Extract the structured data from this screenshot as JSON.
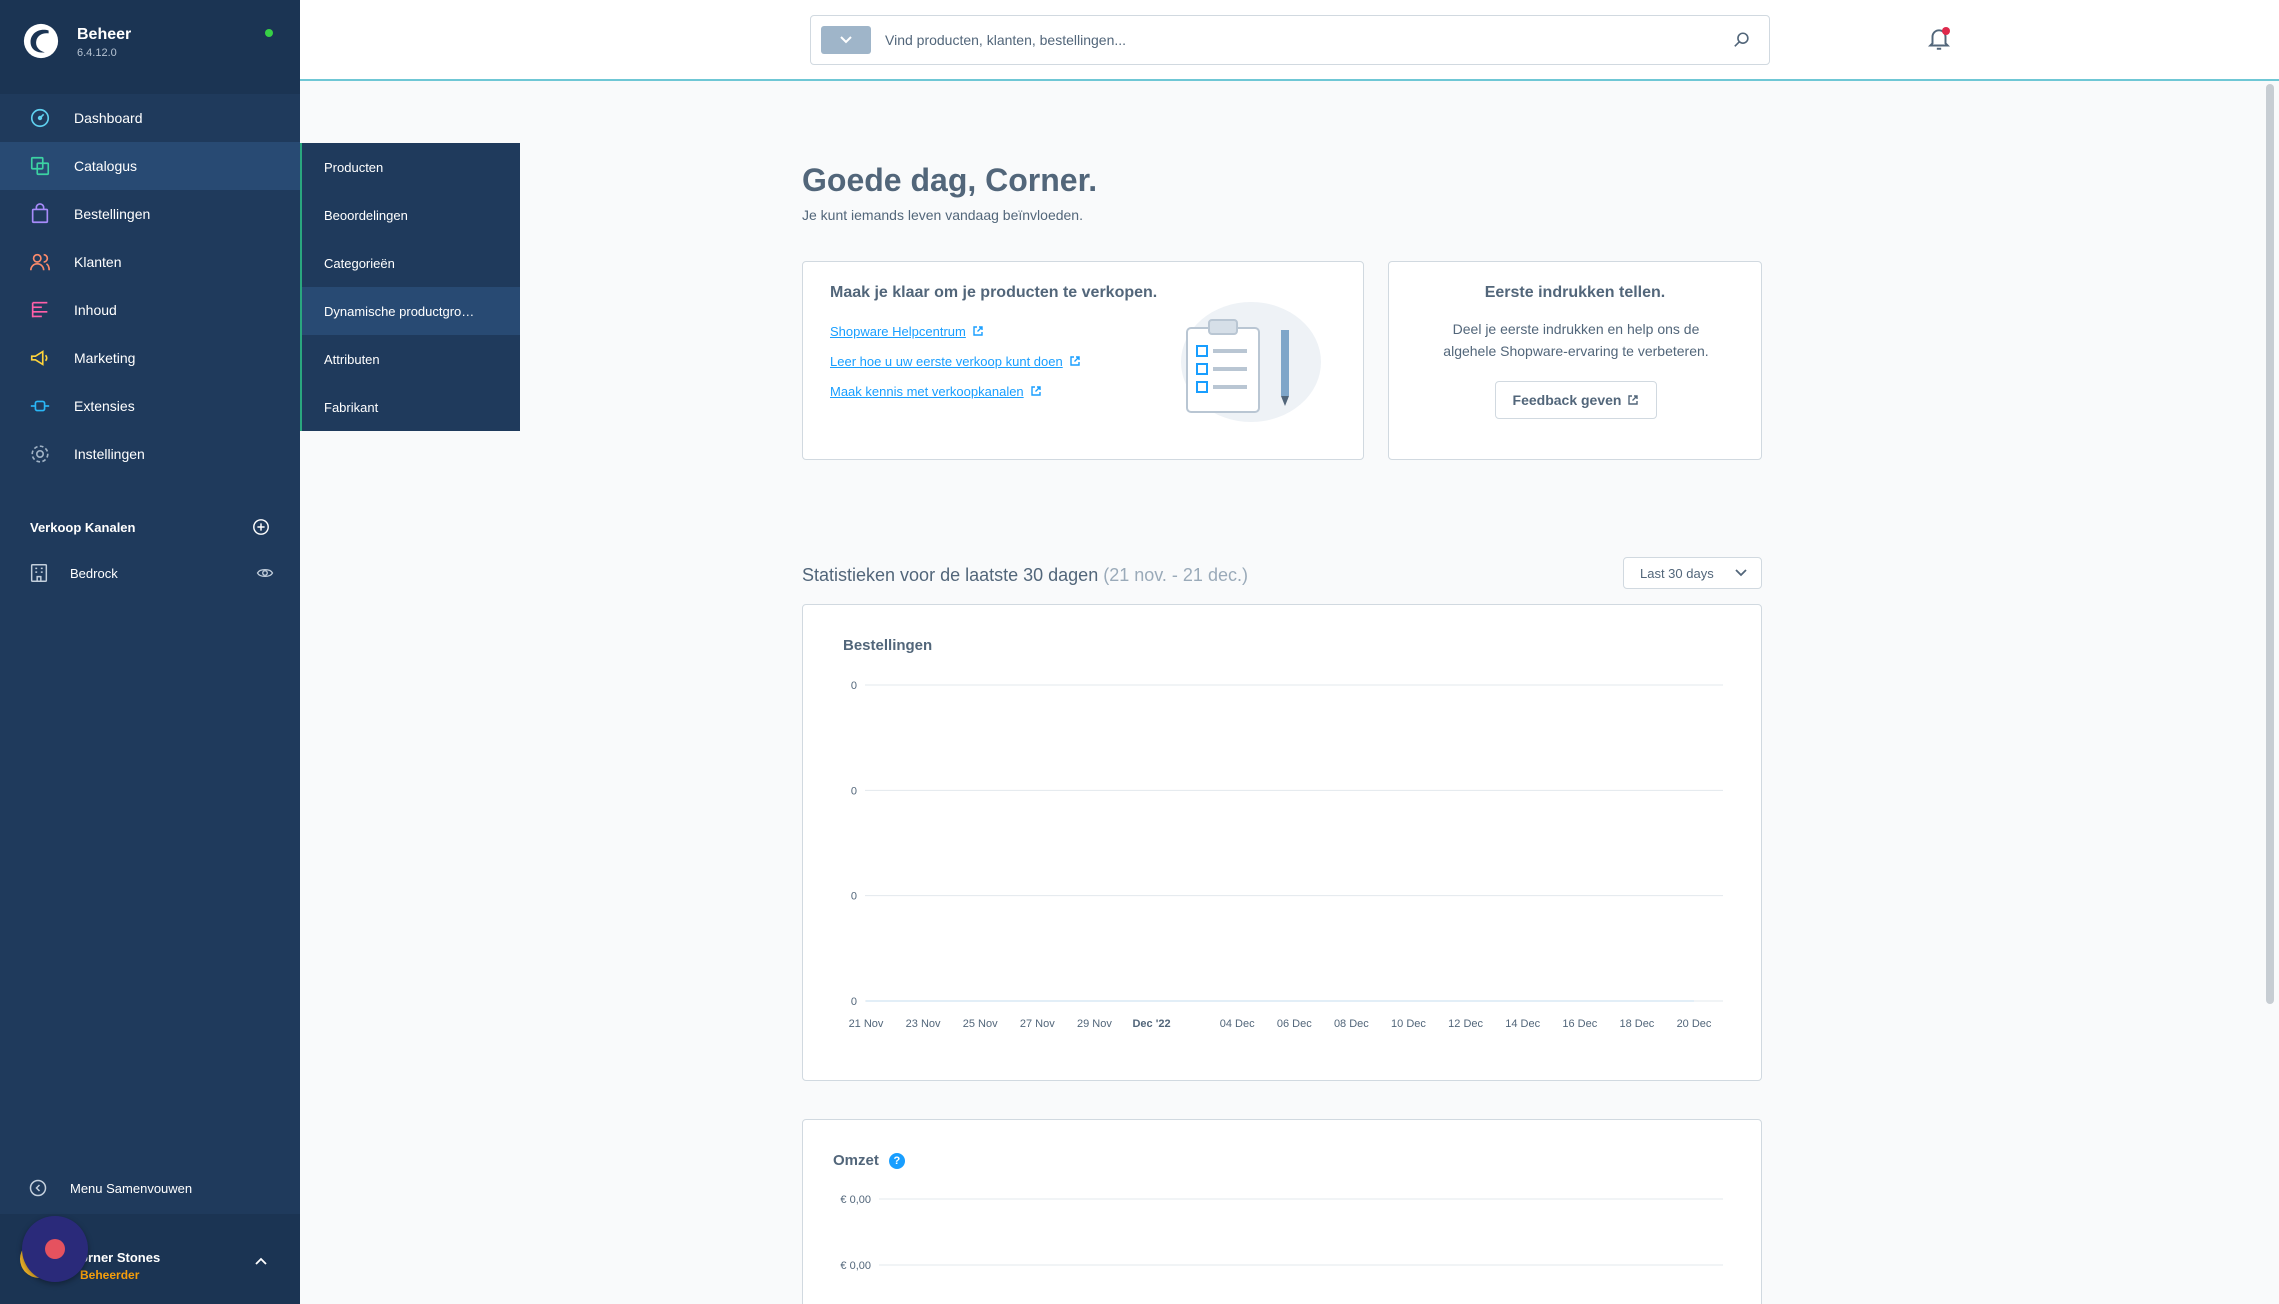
{
  "app": {
    "name": "Beheer",
    "version": "6.4.12.0"
  },
  "nav": [
    {
      "label": "Dashboard",
      "icon": "dashboard-icon"
    },
    {
      "label": "Catalogus",
      "icon": "catalog-icon"
    },
    {
      "label": "Bestellingen",
      "icon": "bag-icon"
    },
    {
      "label": "Klanten",
      "icon": "users-icon"
    },
    {
      "label": "Inhoud",
      "icon": "content-icon"
    },
    {
      "label": "Marketing",
      "icon": "megaphone-icon"
    },
    {
      "label": "Extensies",
      "icon": "plug-icon"
    },
    {
      "label": "Instellingen",
      "icon": "gear-icon"
    }
  ],
  "catalog_flyout": [
    "Producten",
    "Beoordelingen",
    "Categorieën",
    "Dynamische productgro…",
    "Attributen",
    "Fabrikant"
  ],
  "sales_channels": {
    "title": "Verkoop Kanalen",
    "items": [
      {
        "label": "Bedrock"
      }
    ]
  },
  "sidebar_footer": {
    "collapse_label": "Menu Samenvouwen",
    "user_name": "orner Stones",
    "user_role": "Beheerder"
  },
  "search": {
    "placeholder": "Vind producten, klanten, bestellingen..."
  },
  "greeting": {
    "title": "Goede dag, Corner.",
    "subtitle": "Je kunt iemands leven vandaag beïnvloeden."
  },
  "sell_card": {
    "title": "Maak je klaar om je producten te verkopen.",
    "links": [
      "Shopware Helpcentrum",
      "Leer hoe u uw eerste verkoop kunt doen",
      "Maak kennis met verkoopkanalen"
    ]
  },
  "feedback_card": {
    "title": "Eerste indrukken tellen.",
    "text": "Deel je eerste indrukken en help ons de algehele Shopware-ervaring te verbeteren.",
    "button": "Feedback geven"
  },
  "stats": {
    "title": "Statistieken voor de laatste 30 dagen",
    "range": "(21 nov. - 21 dec.)",
    "select": "Last 30 days"
  },
  "colors": {
    "sidebar": "#1f3a5c",
    "accent": "#189eff",
    "active_dot": "#37d046"
  },
  "chart_data": [
    {
      "type": "line",
      "title": "Bestellingen",
      "x": [
        "21 Nov",
        "23 Nov",
        "25 Nov",
        "27 Nov",
        "29 Nov",
        "Dec '22",
        "04 Dec",
        "06 Dec",
        "08 Dec",
        "10 Dec",
        "12 Dec",
        "14 Dec",
        "16 Dec",
        "18 Dec",
        "20 Dec"
      ],
      "y_ticks": [
        "0",
        "0",
        "0",
        "0"
      ],
      "series": [
        {
          "values": [
            0,
            0,
            0,
            0,
            0,
            0,
            0,
            0,
            0,
            0,
            0,
            0,
            0,
            0,
            0
          ]
        }
      ],
      "grid": true
    },
    {
      "type": "line",
      "title": "Omzet",
      "y_ticks": [
        "€ 0,00",
        "€ 0,00"
      ],
      "grid": true
    }
  ]
}
